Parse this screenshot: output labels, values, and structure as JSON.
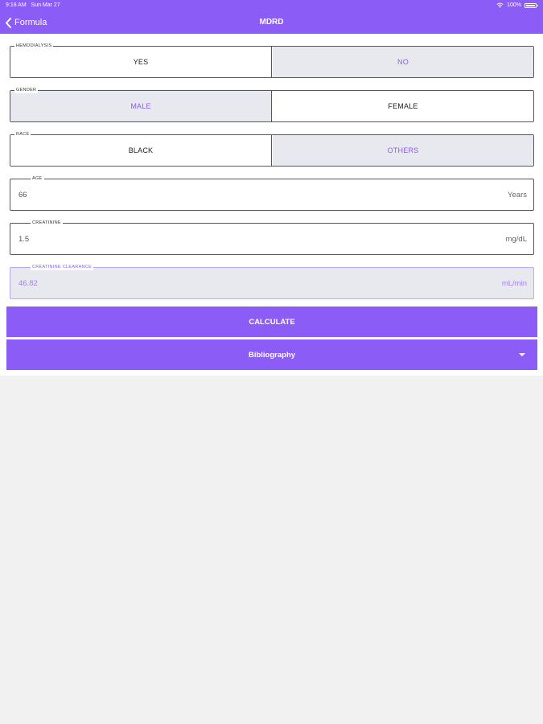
{
  "status_bar": {
    "time": "9:18 AM",
    "date": "Sun Mar 27",
    "battery": "100%"
  },
  "header": {
    "back_label": "Formula",
    "title": "MDRD"
  },
  "form": {
    "hemodialysis": {
      "label": "HEMODIALYSIS",
      "options": [
        "YES",
        "NO"
      ],
      "selected": "NO"
    },
    "gender": {
      "label": "GENDER",
      "options": [
        "MALE",
        "FEMALE"
      ],
      "selected": "MALE"
    },
    "race": {
      "label": "RACE",
      "options": [
        "BLACK",
        "OTHERS"
      ],
      "selected": "OTHERS"
    },
    "age": {
      "label": "AGE",
      "value": "66",
      "unit": "Years"
    },
    "creatinine": {
      "label": "CREATININE",
      "value": "1.5",
      "unit": "mg/dL"
    },
    "clearance": {
      "label": "CREATININE CLEARANCE",
      "value": "46.82",
      "unit": "mL/min"
    }
  },
  "buttons": {
    "calculate": "CALCULATE",
    "bibliography": "Bibliography"
  },
  "colors": {
    "accent": "#8b5cf6",
    "selected_bg": "#e8e9ee",
    "background": "#f1f1f1"
  }
}
